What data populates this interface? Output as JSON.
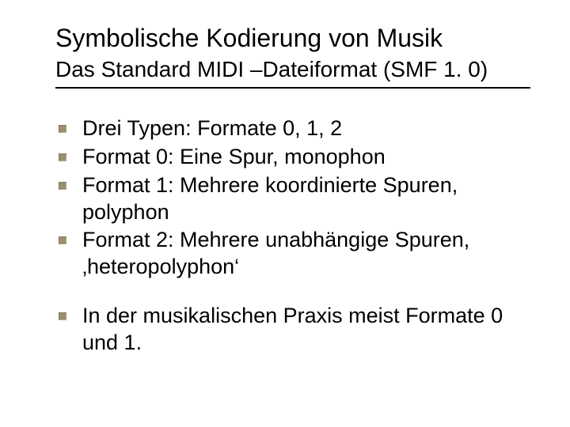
{
  "title": "Symbolische Kodierung von Musik",
  "subtitle": "Das Standard MIDI –Dateiformat (SMF 1. 0)",
  "group1": {
    "b0": "Drei Typen: Formate 0, 1, 2",
    "b1": "Format 0: Eine Spur, monophon",
    "b2": "Format 1: Mehrere koordinierte Spuren, polyphon",
    "b3": "Format 2: Mehrere unabhängige Spuren, ‚heteropolyphon‘"
  },
  "group2": {
    "b0": "In der musikalischen Praxis meist Formate 0 und 1."
  }
}
